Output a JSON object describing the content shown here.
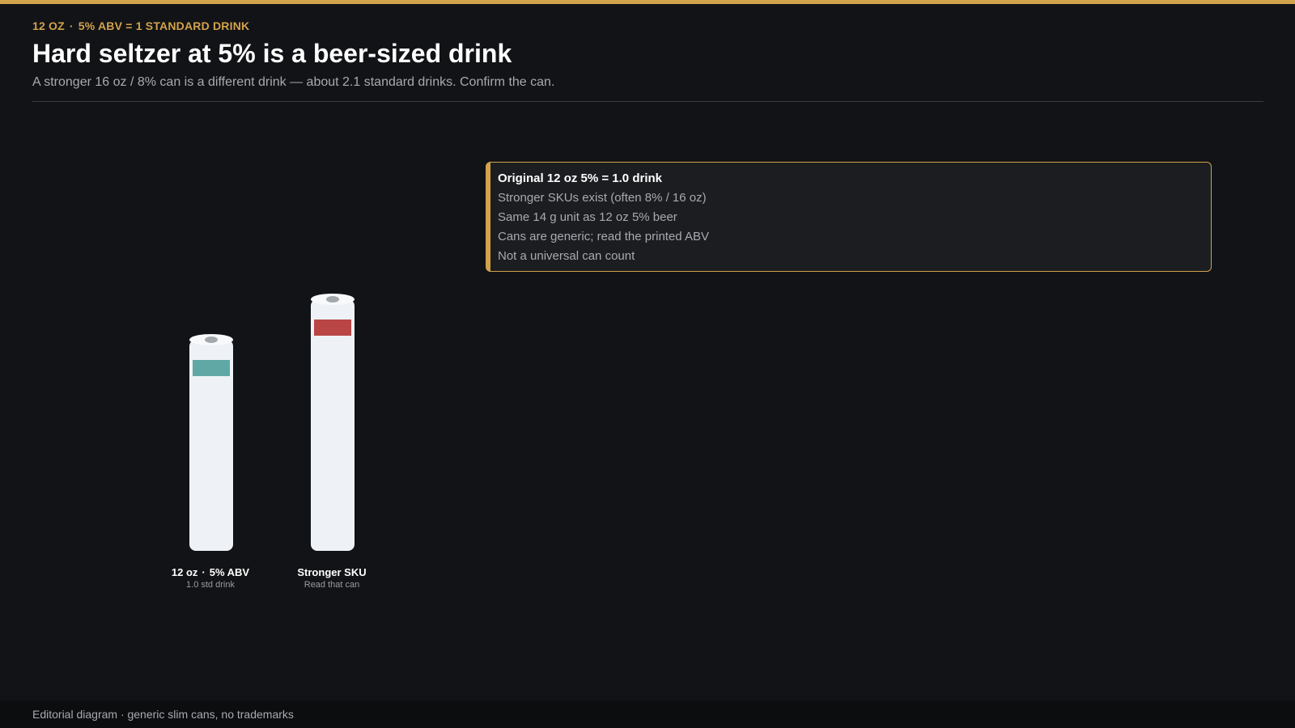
{
  "header": {
    "kicker_left": "12 OZ",
    "kicker_separator": "·",
    "kicker_right": "5% ABV = 1 STANDARD DRINK",
    "title": "Hard seltzer at 5% is a beer-sized drink",
    "subtitle": "A stronger 16 oz / 8% can is a different drink — about 2.1 standard drinks. Confirm the can."
  },
  "callout": {
    "heading": "Original 12 oz 5% = 1.0 drink",
    "items": [
      "Stronger SKUs exist (often 8% / 16 oz)",
      "Same 14 g unit as 12 oz 5% beer",
      "Cans are generic; read the printed ABV",
      "Not a universal can count"
    ]
  },
  "cans": [
    {
      "label_left": "12 oz",
      "label_separator": "·",
      "label_right": "5% ABV",
      "sublabel": "1.0 std drink",
      "band_color": "#5fa8a5"
    },
    {
      "label": "Stronger SKU",
      "sublabel": "Read that can",
      "band_color": "#b94644"
    }
  ],
  "colors": {
    "accent": "#d2a24c",
    "background": "#121316",
    "can_body": "#eef2f6"
  },
  "footer": {
    "text": "Editorial diagram · generic slim cans, no trademarks"
  }
}
